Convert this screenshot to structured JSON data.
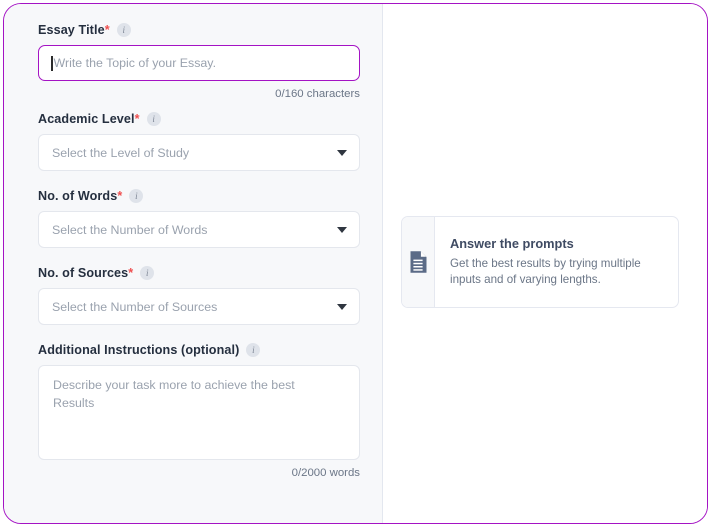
{
  "theme": {
    "accent": "#a413c4",
    "panel_bg": "#f7f8fa",
    "required_mark": "#ef4f4f",
    "label_text": "#252f3f",
    "placeholder_text": "#9aa2ae",
    "muted_text": "#6b7687",
    "field_border": "#e4e7ed",
    "hint_icon": "#5b6b87"
  },
  "form": {
    "fields": [
      {
        "id": "essay-title",
        "label": "Essay Title",
        "required_mark": "*",
        "info_icon": "info-icon",
        "type": "text",
        "value": "",
        "placeholder": "Write the Topic of your Essay.",
        "focused": true,
        "counter": "0/160 characters"
      },
      {
        "id": "academic-level",
        "label": "Academic Level",
        "required_mark": "*",
        "info_icon": "info-icon",
        "type": "select",
        "value": "",
        "placeholder": "Select the Level of Study",
        "chevron_icon": "chevron-down-icon"
      },
      {
        "id": "no-of-words",
        "label": "No. of Words",
        "required_mark": "*",
        "info_icon": "info-icon",
        "type": "select",
        "value": "",
        "placeholder": "Select the Number of Words",
        "chevron_icon": "chevron-down-icon"
      },
      {
        "id": "no-of-sources",
        "label": "No. of Sources",
        "required_mark": "*",
        "info_icon": "info-icon",
        "type": "select",
        "value": "",
        "placeholder": "Select the Number of Sources",
        "chevron_icon": "chevron-down-icon"
      },
      {
        "id": "additional-instructions",
        "label": "Additional Instructions (optional)",
        "required_mark": "",
        "info_icon": "info-icon",
        "type": "textarea",
        "value": "",
        "placeholder": "Describe your task more to achieve the best Results",
        "counter": "0/2000 words"
      }
    ]
  },
  "hint_card": {
    "icon": "document-icon",
    "title": "Answer the prompts",
    "description": "Get the best results by trying multiple inputs and of varying lengths."
  }
}
